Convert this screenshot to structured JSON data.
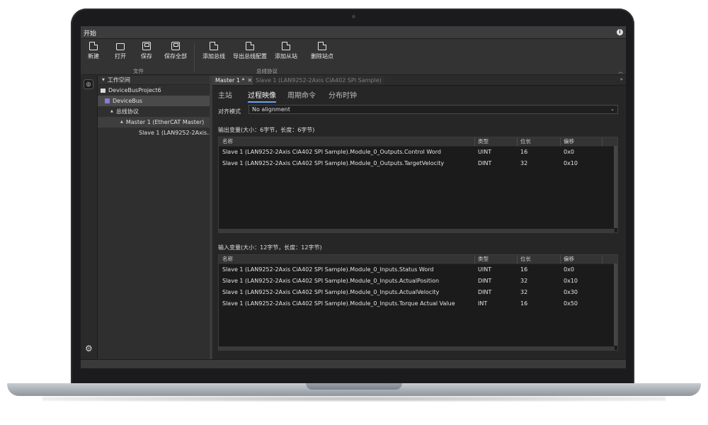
{
  "titlebar": {
    "tab_label": "开始",
    "info_icon": "info-icon"
  },
  "ribbon": {
    "file_group": {
      "label": "文件",
      "buttons": [
        {
          "label": "新建",
          "icon": "new-file-icon"
        },
        {
          "label": "打开",
          "icon": "open-folder-icon"
        },
        {
          "label": "保存",
          "icon": "save-icon"
        },
        {
          "label": "保存全部",
          "icon": "save-all-icon"
        }
      ]
    },
    "bus_group": {
      "label": "总线协议",
      "buttons": [
        {
          "label": "添加总线",
          "icon": "add-bus-icon"
        },
        {
          "label": "导出总线配置",
          "icon": "export-config-icon"
        },
        {
          "label": "添加从站",
          "icon": "add-slave-icon"
        },
        {
          "label": "删除站点",
          "icon": "delete-node-icon"
        }
      ]
    }
  },
  "tree": {
    "header": "工作空间",
    "items": [
      {
        "label": "DeviceBusProject6"
      },
      {
        "label": "DeviceBus"
      },
      {
        "label": "总线协议"
      },
      {
        "label": "Master  1  (EtherCAT  Master)"
      },
      {
        "label": "Slave  1  (LAN9252-2Axis..."
      }
    ]
  },
  "doc_tabs": [
    {
      "label": "Master  1  *"
    },
    {
      "label": "Slave  1  (LAN9252-2Axis  CiA402  SPI  Sample)"
    }
  ],
  "sub_tabs": [
    "主站",
    "过程映像",
    "周期命令",
    "分布时钟"
  ],
  "alignment": {
    "label": "对齐模式",
    "value": "No  alignment"
  },
  "output": {
    "title": "输出变量(大小：6字节，长度：6字节)",
    "columns": [
      "名称",
      "类型",
      "位长",
      "偏移"
    ],
    "rows": [
      [
        "Slave  1  (LAN9252-2Axis  CiA402  SPI  Sample).Module_0_Outputs.Control  Word",
        "UINT",
        "16",
        "0x0"
      ],
      [
        "Slave  1  (LAN9252-2Axis  CiA402  SPI  Sample).Module_0_Outputs.TargetVelocity",
        "DINT",
        "32",
        "0x10"
      ]
    ]
  },
  "input": {
    "title": "输入变量(大小：12字节，长度：12字节)",
    "columns": [
      "名称",
      "类型",
      "位长",
      "偏移"
    ],
    "rows": [
      [
        "Slave  1  (LAN9252-2Axis  CiA402  SPI  Sample).Module_0_Inputs.Status  Word",
        "UINT",
        "16",
        "0x0"
      ],
      [
        "Slave  1  (LAN9252-2Axis  CiA402  SPI  Sample).Module_0_Inputs.ActualPosition",
        "DINT",
        "32",
        "0x10"
      ],
      [
        "Slave  1  (LAN9252-2Axis  CiA402  SPI  Sample).Module_0_Inputs.ActualVelocity",
        "DINT",
        "32",
        "0x30"
      ],
      [
        "Slave  1  (LAN9252-2Axis  CiA402  SPI  Sample).Module_0_Inputs.Torque  Actual  Value",
        "INT",
        "16",
        "0x50"
      ]
    ]
  }
}
